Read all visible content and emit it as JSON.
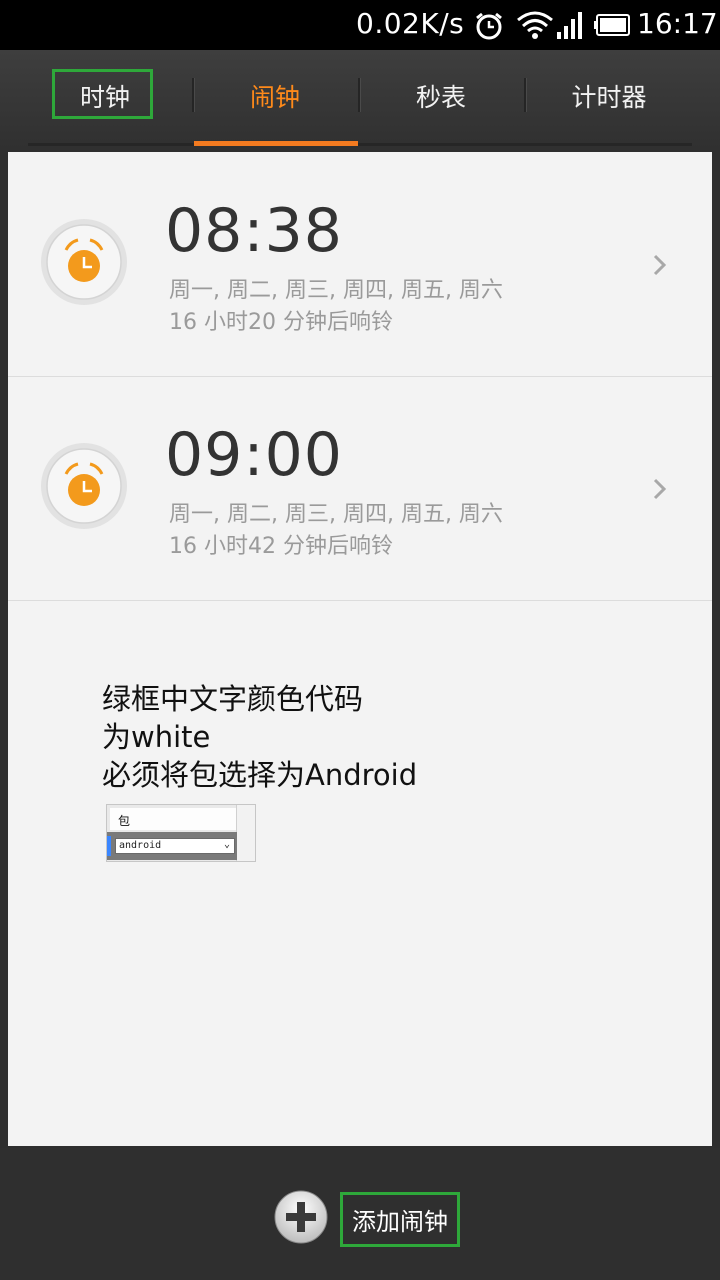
{
  "status_bar": {
    "net_speed": "0.02K/s",
    "time": "16:17",
    "icons": [
      "alarm-clock-icon",
      "wifi-icon",
      "signal-icon",
      "battery-icon"
    ]
  },
  "tabs": [
    {
      "label": "时钟",
      "active": false
    },
    {
      "label": "闹钟",
      "active": true
    },
    {
      "label": "秒表",
      "active": false
    },
    {
      "label": "计时器",
      "active": false
    }
  ],
  "alarms": [
    {
      "time": "08:38",
      "days": "周一, 周二, 周三, 周四, 周五, 周六",
      "remaining": "16 小时20 分钟后响铃"
    },
    {
      "time": "09:00",
      "days": "周一, 周二, 周三, 周四, 周五, 周六",
      "remaining": "16 小时42 分钟后响铃"
    }
  ],
  "note": {
    "line1": "绿框中文字颜色代码",
    "line2": "为white",
    "line3": "必须将包选择为Android"
  },
  "package_panel": {
    "label": "包",
    "selected": "android"
  },
  "bottom": {
    "add_label": "添加闹钟"
  },
  "colors": {
    "accent": "#f47b20",
    "highlight_box": "#2ea83a"
  }
}
